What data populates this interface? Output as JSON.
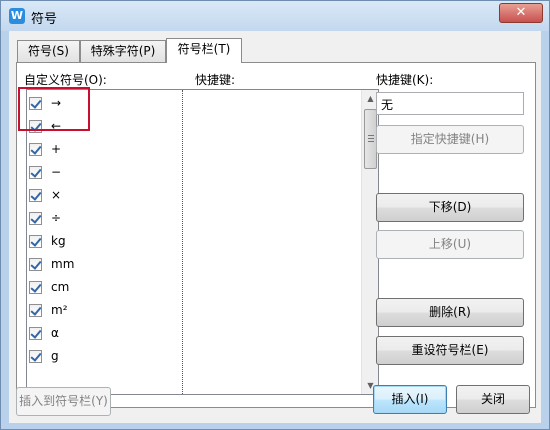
{
  "window": {
    "title": "符号",
    "close_glyph": "✕",
    "app_icon_glyph": "W"
  },
  "tabs": [
    {
      "label": "符号(S)",
      "active": false
    },
    {
      "label": "特殊字符(P)",
      "active": false
    },
    {
      "label": "符号栏(T)",
      "active": true
    }
  ],
  "panel": {
    "list_label": "自定义符号(O):",
    "shortcut_column_label": "快捷键:",
    "shortcut_field_label": "快捷键(K):",
    "shortcut_value": "无",
    "items": [
      {
        "symbol": "→",
        "checked": true
      },
      {
        "symbol": "←",
        "checked": true
      },
      {
        "symbol": "+",
        "checked": true
      },
      {
        "symbol": "−",
        "checked": true
      },
      {
        "symbol": "×",
        "checked": true
      },
      {
        "symbol": "÷",
        "checked": true
      },
      {
        "symbol": "kg",
        "checked": true
      },
      {
        "symbol": "mm",
        "checked": true
      },
      {
        "symbol": "cm",
        "checked": true
      },
      {
        "symbol": "m²",
        "checked": true
      },
      {
        "symbol": "α",
        "checked": true
      },
      {
        "symbol": "g",
        "checked": true
      }
    ],
    "buttons": {
      "assign_shortcut": "指定快捷键(H)",
      "move_down": "下移(D)",
      "move_up": "上移(U)",
      "delete": "删除(R)",
      "reset": "重设符号栏(E)"
    }
  },
  "footer": {
    "insert_to_bar": "插入到符号栏(Y)",
    "insert": "插入(I)",
    "cancel": "关闭"
  },
  "colors": {
    "highlight": "#c8102e",
    "accent": "#2a8de0"
  }
}
